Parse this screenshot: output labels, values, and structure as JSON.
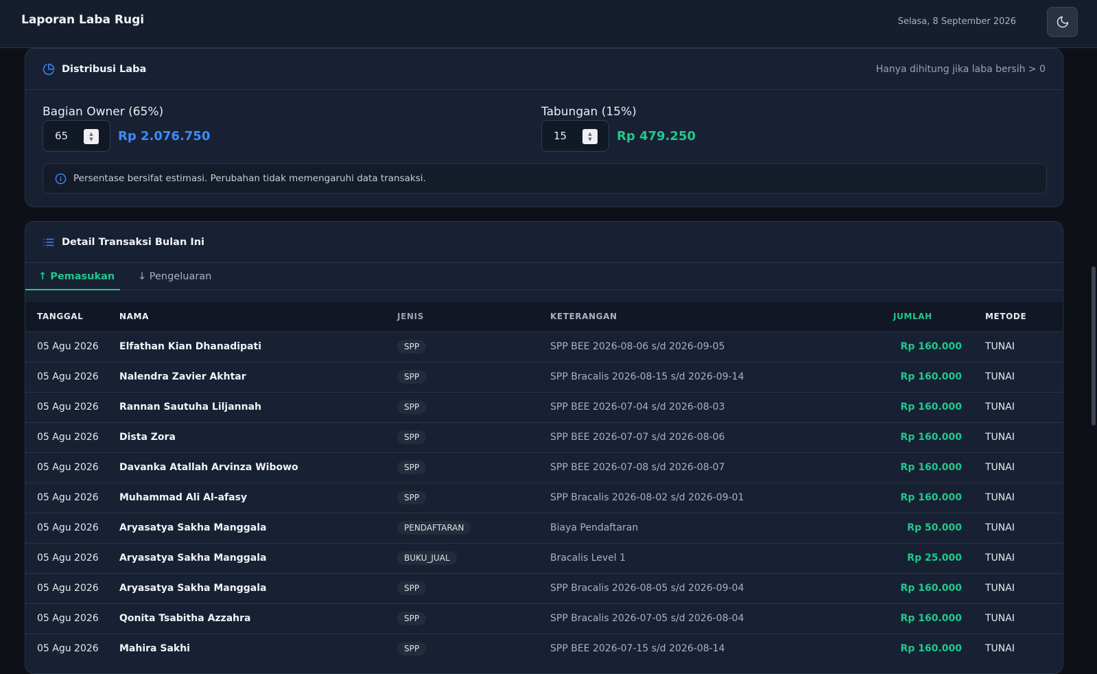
{
  "header": {
    "title": "Laporan Laba Rugi",
    "date": "Selasa, 8 September 2026",
    "theme_icon": "moon-icon"
  },
  "distribution": {
    "title": "Distribusi Laba",
    "note": "Hanya dihitung jika laba bersih > 0",
    "owner": {
      "label": "Bagian Owner (65%)",
      "value": "65",
      "amount": "Rp 2.076.750"
    },
    "savings": {
      "label": "Tabungan (15%)",
      "value": "15",
      "amount": "Rp 479.250"
    },
    "info": "Persentase bersifat estimasi. Perubahan tidak memengaruhi data transaksi."
  },
  "detail": {
    "title": "Detail Transaksi Bulan Ini",
    "tabs": [
      "↑ Pemasukan",
      "↓ Pengeluaran"
    ],
    "columns": [
      "TANGGAL",
      "NAMA",
      "JENIS",
      "KETERANGAN",
      "JUMLAH",
      "METODE"
    ],
    "rows": [
      {
        "date": "05 Agu 2026",
        "name": "Elfathan Kian Dhanadipati",
        "type": "SPP",
        "desc": "SPP BEE 2026-08-06 s/d 2026-09-05",
        "amount": "Rp 160.000",
        "method": "TUNAI"
      },
      {
        "date": "05 Agu 2026",
        "name": "Nalendra Zavier Akhtar",
        "type": "SPP",
        "desc": "SPP Bracalis 2026-08-15 s/d 2026-09-14",
        "amount": "Rp 160.000",
        "method": "TUNAI"
      },
      {
        "date": "05 Agu 2026",
        "name": "Rannan Sautuha Liljannah",
        "type": "SPP",
        "desc": "SPP BEE 2026-07-04 s/d 2026-08-03",
        "amount": "Rp 160.000",
        "method": "TUNAI"
      },
      {
        "date": "05 Agu 2026",
        "name": "Dista Zora",
        "type": "SPP",
        "desc": "SPP BEE 2026-07-07 s/d 2026-08-06",
        "amount": "Rp 160.000",
        "method": "TUNAI"
      },
      {
        "date": "05 Agu 2026",
        "name": "Davanka Atallah Arvinza Wibowo",
        "type": "SPP",
        "desc": "SPP BEE 2026-07-08 s/d 2026-08-07",
        "amount": "Rp 160.000",
        "method": "TUNAI"
      },
      {
        "date": "05 Agu 2026",
        "name": "Muhammad Ali Al-afasy",
        "type": "SPP",
        "desc": "SPP Bracalis 2026-08-02 s/d 2026-09-01",
        "amount": "Rp 160.000",
        "method": "TUNAI"
      },
      {
        "date": "05 Agu 2026",
        "name": "Aryasatya Sakha Manggala",
        "type": "PENDAFTARAN",
        "desc": "Biaya Pendaftaran",
        "amount": "Rp 50.000",
        "method": "TUNAI"
      },
      {
        "date": "05 Agu 2026",
        "name": "Aryasatya Sakha Manggala",
        "type": "BUKU_JUAL",
        "desc": "Bracalis Level 1",
        "amount": "Rp 25.000",
        "method": "TUNAI"
      },
      {
        "date": "05 Agu 2026",
        "name": "Aryasatya Sakha Manggala",
        "type": "SPP",
        "desc": "SPP Bracalis 2026-08-05 s/d 2026-09-04",
        "amount": "Rp 160.000",
        "method": "TUNAI"
      },
      {
        "date": "05 Agu 2026",
        "name": "Qonita Tsabitha Azzahra",
        "type": "SPP",
        "desc": "SPP Bracalis 2026-07-05 s/d 2026-08-04",
        "amount": "Rp 160.000",
        "method": "TUNAI"
      },
      {
        "date": "05 Agu 2026",
        "name": "Mahira Sakhi",
        "type": "SPP",
        "desc": "SPP BEE 2026-07-15 s/d 2026-08-14",
        "amount": "Rp 160.000",
        "method": "TUNAI"
      }
    ]
  }
}
